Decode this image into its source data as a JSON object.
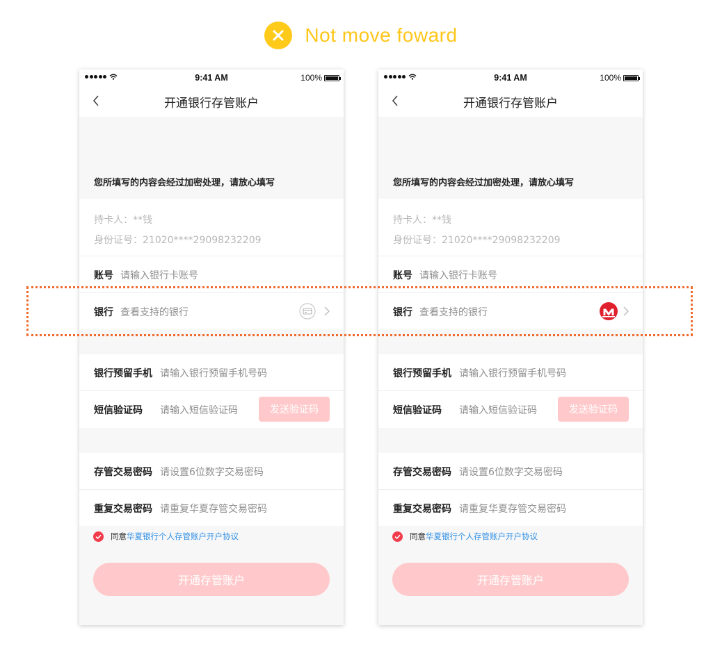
{
  "header": {
    "title": "Not move foward",
    "accent_color": "#FFC61A",
    "icon": "close-icon"
  },
  "highlight_color": "#EE6A2D",
  "phones": [
    {
      "status": {
        "time": "9:41 AM",
        "battery": "100%"
      },
      "nav_title": "开通银行存管账户",
      "notice": "您所填写的内容会经过加密处理，请放心填写",
      "cardholder": "持卡人：**钱",
      "id_number": "身份证号：21020****29098232209",
      "account": {
        "label": "账号",
        "placeholder": "请输入银行卡账号"
      },
      "bank": {
        "label": "银行",
        "placeholder": "查看支持的银行",
        "icon": "card-icon"
      },
      "phone_field": {
        "label": "银行预留手机",
        "placeholder": "请输入银行预留手机号码"
      },
      "sms": {
        "label": "短信验证码",
        "placeholder": "请输入短信验证码",
        "button": "发送验证码"
      },
      "trade_pwd": {
        "label": "存管交易密码",
        "placeholder": "请设置6位数字交易密码"
      },
      "repeat_pwd": {
        "label": "重复交易密码",
        "placeholder": "请重复华夏存管交易密码"
      },
      "agree": {
        "prefix": "同意",
        "link": "华夏银行个人存管账户开户协议"
      },
      "submit": "开通存管账户"
    },
    {
      "status": {
        "time": "9:41 AM",
        "battery": "100%"
      },
      "nav_title": "开通银行存管账户",
      "notice": "您所填写的内容会经过加密处理，请放心填写",
      "cardholder": "持卡人：**钱",
      "id_number": "身份证号：21020****29098232209",
      "account": {
        "label": "账号",
        "placeholder": "请输入银行卡账号"
      },
      "bank": {
        "label": "银行",
        "placeholder": "查看支持的银行",
        "icon": "bank-logo-icon"
      },
      "phone_field": {
        "label": "银行预留手机",
        "placeholder": "请输入银行预留手机号码"
      },
      "sms": {
        "label": "短信验证码",
        "placeholder": "请输入短信验证码",
        "button": "发送验证码"
      },
      "trade_pwd": {
        "label": "存管交易密码",
        "placeholder": "请设置6位数字交易密码"
      },
      "repeat_pwd": {
        "label": "重复交易密码",
        "placeholder": "请重复华夏存管交易密码"
      },
      "agree": {
        "prefix": "同意",
        "link": "华夏银行个人存管账户开户协议"
      },
      "submit": "开通存管账户"
    }
  ]
}
